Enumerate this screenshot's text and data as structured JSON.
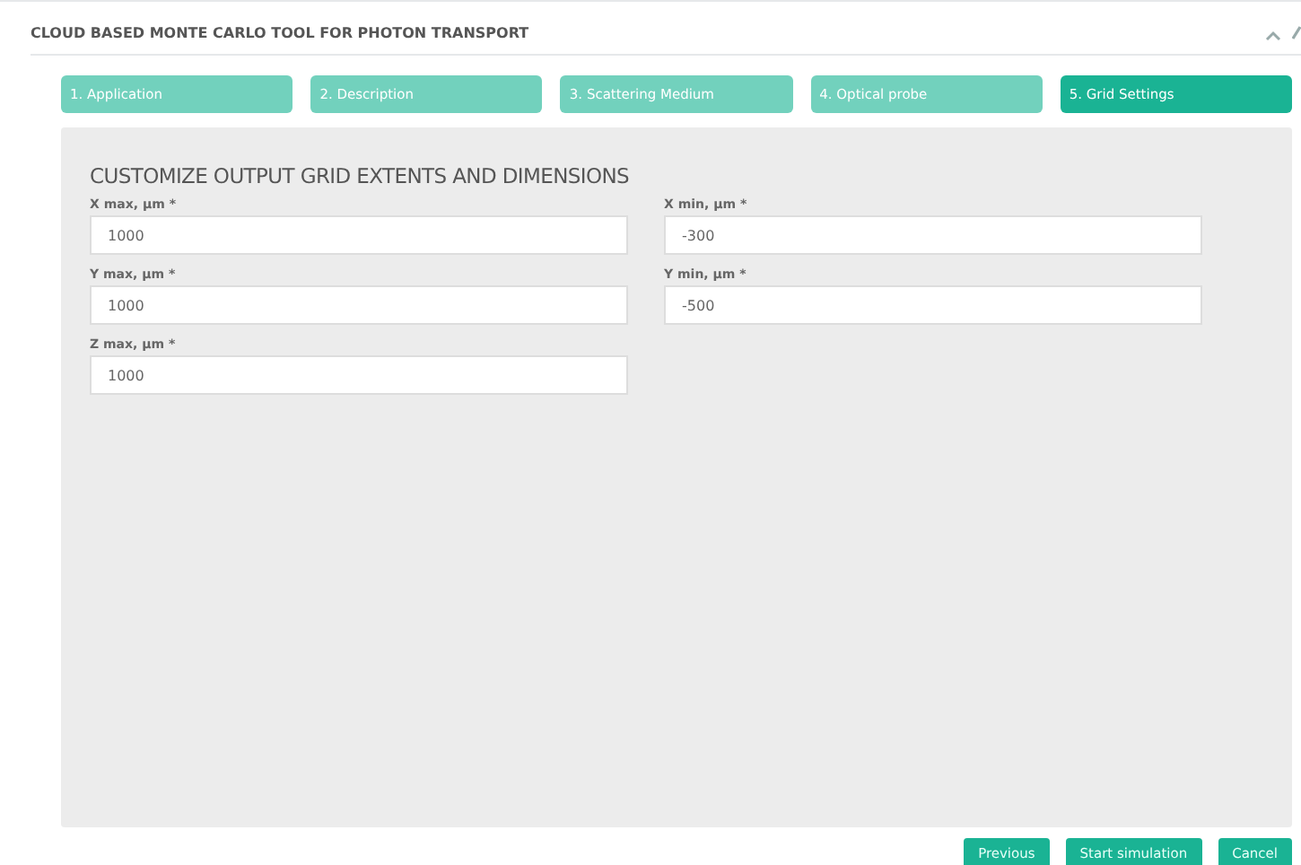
{
  "panel": {
    "title": "CLOUD BASED MONTE CARLO TOOL FOR PHOTON TRANSPORT"
  },
  "steps": [
    {
      "label": "1. Application",
      "selected": false
    },
    {
      "label": "2. Description",
      "selected": false
    },
    {
      "label": "3. Scattering Medium",
      "selected": false
    },
    {
      "label": "4. Optical probe",
      "selected": false
    },
    {
      "label": "5. Grid Settings",
      "selected": true
    }
  ],
  "form": {
    "heading": "CUSTOMIZE OUTPUT GRID EXTENTS AND DIMENSIONS",
    "fields": [
      {
        "label": "X max, µm *",
        "value": "1000"
      },
      {
        "label": "X min, µm *",
        "value": "-300"
      },
      {
        "label": "Y max, µm *",
        "value": "1000"
      },
      {
        "label": "Y min, µm *",
        "value": "-500"
      },
      {
        "label": "Z max, µm *",
        "value": "1000"
      }
    ]
  },
  "buttons": [
    "Previous",
    "Start simulation",
    "Cancel"
  ]
}
